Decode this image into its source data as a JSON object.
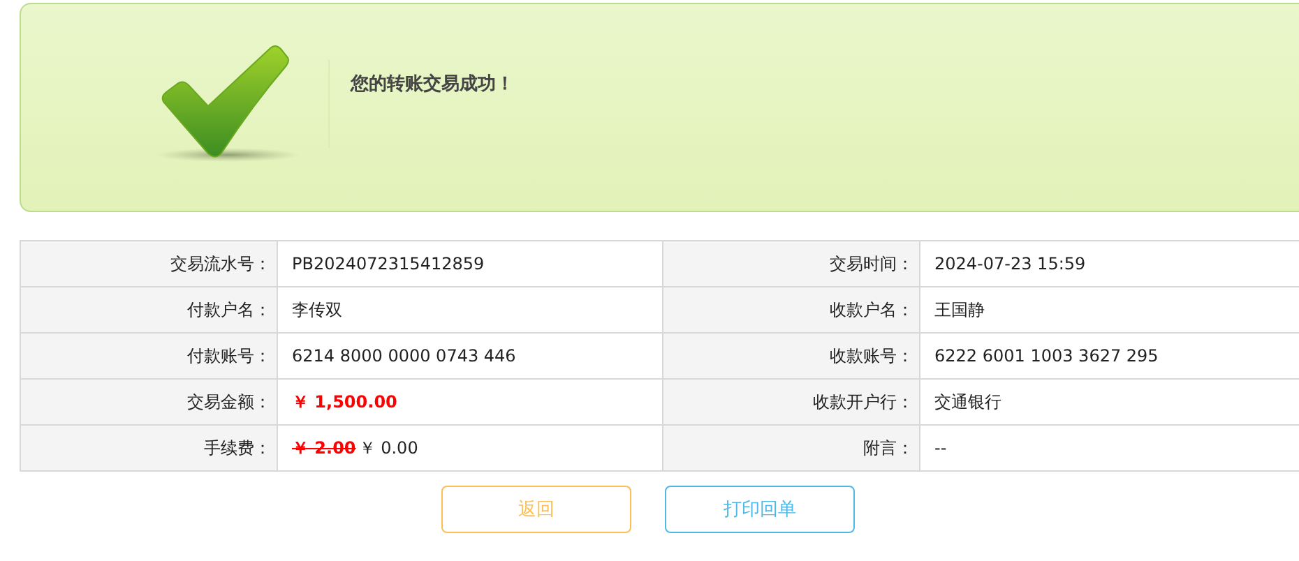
{
  "banner": {
    "message": "您的转账交易成功！"
  },
  "details": [
    {
      "label": "交易流水号：",
      "value": "PB2024072315412859",
      "kind": "plain"
    },
    {
      "label": "交易时间：",
      "value": "2024-07-23 15:59",
      "kind": "plain"
    },
    {
      "label": "付款户名：",
      "value": "李传双",
      "kind": "plain"
    },
    {
      "label": "收款户名：",
      "value": "王国静",
      "kind": "plain"
    },
    {
      "label": "付款账号：",
      "value": "6214 8000 0000 0743 446",
      "kind": "plain"
    },
    {
      "label": "收款账号：",
      "value": "6222 6001 1003 3627 295",
      "kind": "plain"
    },
    {
      "label": "交易金额：",
      "value": "￥ 1,500.00",
      "kind": "amount"
    },
    {
      "label": "收款开户行：",
      "value": "交通银行",
      "kind": "plain"
    },
    {
      "label": "手续费：",
      "original": "￥ 2.00",
      "value": "￥ 0.00",
      "kind": "fee"
    },
    {
      "label": "附言：",
      "value": "--",
      "kind": "plain"
    }
  ],
  "buttons": [
    {
      "label": "返回",
      "color": "#fbbf55"
    },
    {
      "label": "打印回单",
      "color": "#4fb8e6"
    }
  ]
}
